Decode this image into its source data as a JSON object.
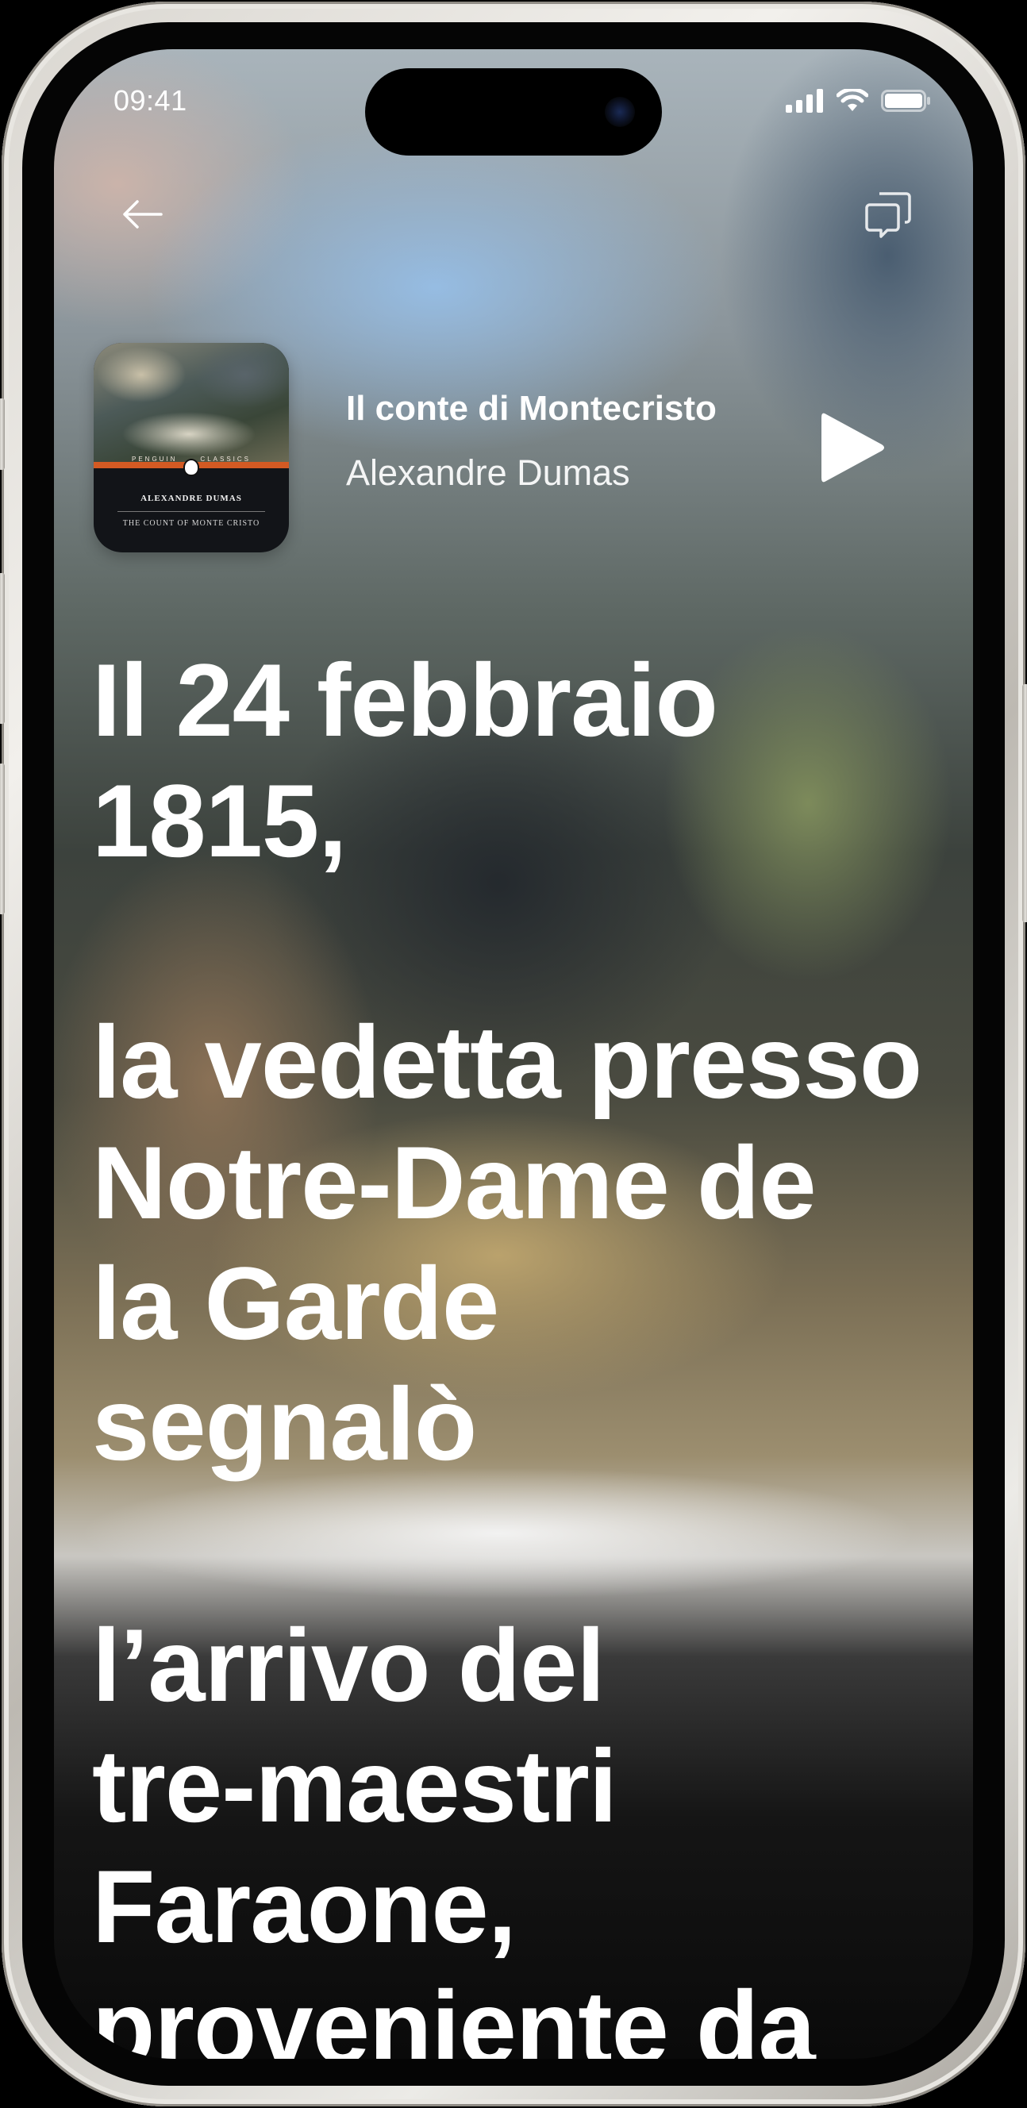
{
  "status_bar": {
    "time": "09:41",
    "icons": [
      "cellular-signal-icon",
      "wifi-icon",
      "battery-icon"
    ]
  },
  "nav": {
    "back_icon": "back-arrow-icon",
    "chat_icon": "chat-bubbles-icon"
  },
  "book": {
    "title": "Il conte di Montecristo",
    "author": "Alexandre Dumas",
    "cover": {
      "series": [
        "PENGUIN",
        "CLASSICS"
      ],
      "author": "ALEXANDRE DUMAS",
      "title": "THE COUNT OF MONTE CRISTO"
    },
    "play_icon": "play-icon"
  },
  "reading": {
    "paragraphs": [
      "Il 24 febbraio\n1815,",
      "la vedetta presso\nNotre-Dame de\nla Garde\nsegnalò",
      "l’arrivo del\ntre-maestri\nFaraone,\nproveniente da\nSmirne, Trieste"
    ]
  },
  "colors": {
    "text": "#ffffff",
    "cover_band": "#d35a23"
  }
}
